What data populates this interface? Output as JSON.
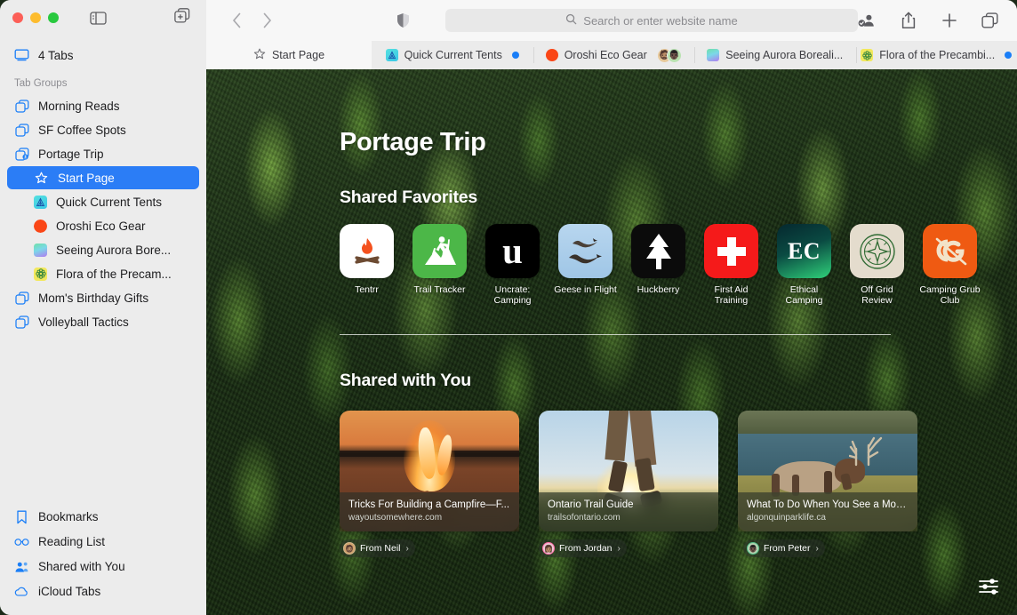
{
  "window": {
    "traffic_lights": [
      "close",
      "minimize",
      "zoom"
    ]
  },
  "sidebar": {
    "tabs_row": {
      "label": "4 Tabs",
      "icon": "display-icon"
    },
    "group_header": "Tab Groups",
    "groups": [
      {
        "label": "Morning Reads",
        "icon": "tab-group-icon"
      },
      {
        "label": "SF Coffee Spots",
        "icon": "tab-group-icon"
      },
      {
        "label": "Portage Trip",
        "icon": "tab-group-shared-icon"
      }
    ],
    "portage_children": [
      {
        "label": "Start Page",
        "icon": "star-icon",
        "selected": true
      },
      {
        "label": "Quick Current Tents",
        "icon": "favicon-tent",
        "color": "#3fd6d6"
      },
      {
        "label": "Oroshi Eco Gear",
        "icon": "favicon-circle",
        "color": "#fa4616"
      },
      {
        "label": "Seeing Aurora Bore...",
        "icon": "favicon-aurora",
        "color": "#6fe0a8"
      },
      {
        "label": "Flora of the Precam...",
        "icon": "favicon-flora",
        "color": "#f2e85c"
      }
    ],
    "groups_after": [
      {
        "label": "Mom's Birthday Gifts",
        "icon": "tab-group-icon"
      },
      {
        "label": "Volleyball Tactics",
        "icon": "tab-group-icon"
      }
    ],
    "bottom_items": [
      {
        "label": "Bookmarks",
        "icon": "bookmark-icon"
      },
      {
        "label": "Reading List",
        "icon": "glasses-icon"
      },
      {
        "label": "Shared with You",
        "icon": "shared-people-icon"
      },
      {
        "label": "iCloud Tabs",
        "icon": "cloud-icon"
      }
    ]
  },
  "toolbar": {
    "back_icon": "chevron-left-icon",
    "forward_icon": "chevron-right-icon",
    "shield_icon": "privacy-shield-icon",
    "search_placeholder": "Search or enter website name",
    "search_value": "",
    "search_icon": "magnifier-icon",
    "right_icons": [
      {
        "name": "shared-with-you-icon"
      },
      {
        "name": "share-icon"
      },
      {
        "name": "new-tab-plus-icon"
      },
      {
        "name": "tab-overview-icon"
      }
    ]
  },
  "tabs": [
    {
      "label": "Start Page",
      "icon": "star-icon",
      "active": true,
      "unread": false
    },
    {
      "label": "Quick Current Tents",
      "icon": "favicon-tent",
      "color": "#3fd6d6",
      "active": false,
      "unread": true
    },
    {
      "label": "Oroshi Eco Gear",
      "icon": "favicon-circle",
      "color": "#fa4616",
      "active": false,
      "unread": false,
      "avatars": [
        "🧔🏽",
        "👨🏿"
      ]
    },
    {
      "label": "Seeing Aurora Boreali...",
      "icon": "favicon-aurora",
      "color": "#6fe0a8",
      "active": false,
      "unread": false
    },
    {
      "label": "Flora of the Precambi...",
      "icon": "favicon-flora",
      "color": "#f2e85c",
      "active": false,
      "unread": true
    }
  ],
  "start_page": {
    "title": "Portage Trip",
    "favorites_heading": "Shared Favorites",
    "favorites": [
      {
        "label": "Tentrr",
        "icon": "campfire-icon",
        "bg": "#ffffff"
      },
      {
        "label": "Trail Tracker",
        "icon": "hiker-icon",
        "bg": "#4cb748"
      },
      {
        "label": "Uncrate: Camping",
        "icon": "letter-u-icon",
        "bg": "#000000"
      },
      {
        "label": "Geese in Flight",
        "icon": "geese-icon",
        "bg": "#a9cbe8"
      },
      {
        "label": "Huckberry",
        "icon": "pine-tree-icon",
        "bg": "#0b0b0b"
      },
      {
        "label": "First Aid Training",
        "icon": "red-cross-icon",
        "bg": "#f51a1a"
      },
      {
        "label": "Ethical Camping",
        "icon": "letters-ec-icon",
        "bg": "#0c3b3a"
      },
      {
        "label": "Off Grid Review",
        "icon": "compass-icon",
        "bg": "#e4dccd"
      },
      {
        "label": "Camping Grub Club",
        "icon": "letters-cg-icon",
        "bg": "#ef5a12"
      }
    ],
    "shared_heading": "Shared with You",
    "shared_cards": [
      {
        "title": "Tricks For Building a Campfire—F...",
        "url": "wayoutsomewhere.com",
        "from": "From Neil",
        "image": "campfire-photo",
        "avatar_emoji": "🧔🏽",
        "avatar_ring": "#d2b48c"
      },
      {
        "title": "Ontario Trail Guide",
        "url": "trailsofontario.com",
        "from": "From Jordan",
        "image": "hiker-sunset-photo",
        "avatar_emoji": "👩🏽",
        "avatar_ring": "#ff6fa8"
      },
      {
        "title": "What To Do When You See a Moo...",
        "url": "algonquinparklife.ca",
        "from": "From Peter",
        "image": "moose-lake-photo",
        "avatar_emoji": "👨🏿",
        "avatar_ring": "#55c08a"
      }
    ],
    "settings_icon": "sliders-icon"
  }
}
